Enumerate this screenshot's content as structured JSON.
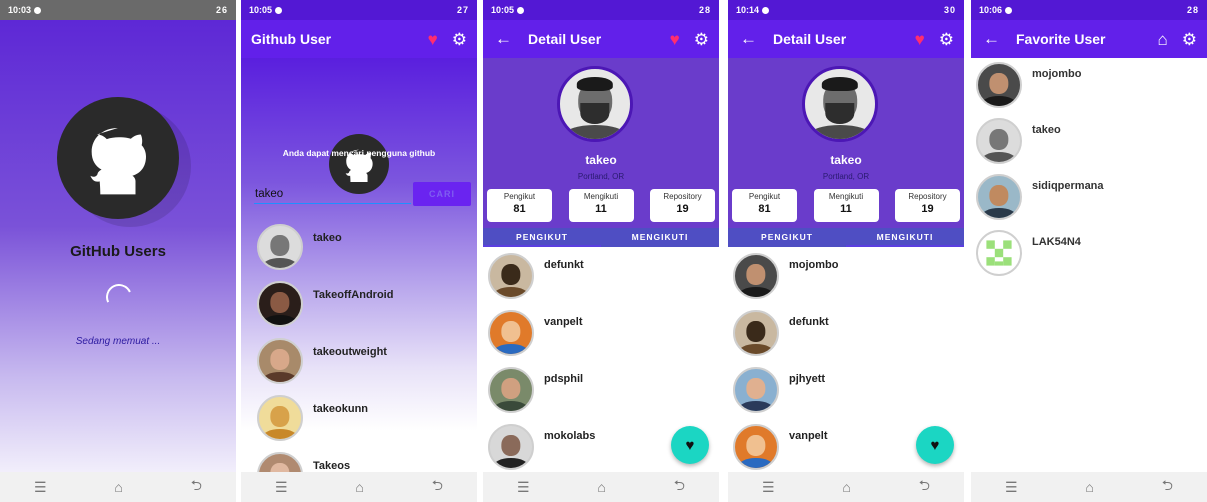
{
  "colors": {
    "primary": "#6220ea",
    "accent_heart": "#ff2d6f",
    "fab": "#1bd6c3"
  },
  "splash": {
    "status_time": "10:03",
    "status_right": "26",
    "title": "GitHub Users",
    "loading_text": "Sedang memuat ..."
  },
  "search": {
    "status_time": "10:05",
    "status_right": "27",
    "app_title": "Github User",
    "hint": "Anda dapat mencari pengguna github",
    "query": "takeo",
    "search_button": "CARI",
    "results": [
      "takeo",
      "TakeoffAndroid",
      "takeoutweight",
      "takeokunn",
      "Takeos"
    ]
  },
  "detail_followers": {
    "status_time": "10:05",
    "status_right": "28",
    "app_title": "Detail User",
    "name": "takeo",
    "location": "Portland, OR",
    "stats": [
      {
        "label": "Pengikut",
        "value": "81"
      },
      {
        "label": "Mengikuti",
        "value": "11"
      },
      {
        "label": "Repository",
        "value": "19"
      }
    ],
    "tabs": [
      "PENGIKUT",
      "MENGIKUTI"
    ],
    "users": [
      "defunkt",
      "vanpelt",
      "pdsphil",
      "mokolabs"
    ]
  },
  "detail_following": {
    "status_time": "10:14",
    "status_right": "30",
    "app_title": "Detail User",
    "name": "takeo",
    "location": "Portland, OR",
    "stats": [
      {
        "label": "Pengikut",
        "value": "81"
      },
      {
        "label": "Mengikuti",
        "value": "11"
      },
      {
        "label": "Repository",
        "value": "19"
      }
    ],
    "tabs": [
      "PENGIKUT",
      "MENGIKUTI"
    ],
    "users": [
      "mojombo",
      "defunkt",
      "pjhyett",
      "vanpelt"
    ]
  },
  "favorites": {
    "status_time": "10:06",
    "status_right": "28",
    "app_title": "Favorite User",
    "users": [
      "mojombo",
      "takeo",
      "sidiqpermana",
      "LAK54N4"
    ]
  },
  "icons": [
    "back-arrow-icon",
    "heart-icon",
    "gear-icon",
    "home-icon",
    "github-octocat-icon",
    "menu-icon",
    "home-nav-icon",
    "back-nav-icon"
  ]
}
